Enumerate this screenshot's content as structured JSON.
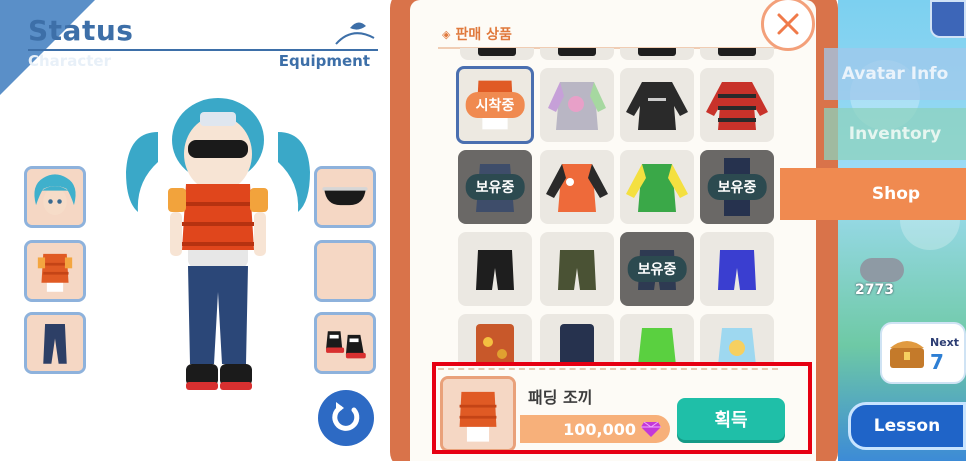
{
  "status_panel": {
    "title": "Status",
    "sub_left": "Character",
    "sub_right": "Equipment",
    "slots_left": [
      "hair-icon",
      "vest-icon",
      "pants-icon"
    ],
    "slots_right": [
      "sunglasses-icon",
      "empty-slot",
      "sneakers-icon"
    ]
  },
  "shop": {
    "title": "판매 상품",
    "items": [
      {
        "row": 1,
        "col": 1,
        "badge": "시착중",
        "state": "trying"
      },
      {
        "row": 1,
        "col": 2,
        "badge": "",
        "state": "normal"
      },
      {
        "row": 1,
        "col": 3,
        "badge": "",
        "state": "normal"
      },
      {
        "row": 1,
        "col": 4,
        "badge": "",
        "state": "normal"
      },
      {
        "row": 2,
        "col": 1,
        "badge": "보유중",
        "state": "owned"
      },
      {
        "row": 2,
        "col": 2,
        "badge": "",
        "state": "normal"
      },
      {
        "row": 2,
        "col": 3,
        "badge": "",
        "state": "normal"
      },
      {
        "row": 2,
        "col": 4,
        "badge": "보유중",
        "state": "owned"
      },
      {
        "row": 3,
        "col": 1,
        "badge": "",
        "state": "normal"
      },
      {
        "row": 3,
        "col": 2,
        "badge": "",
        "state": "normal"
      },
      {
        "row": 3,
        "col": 3,
        "badge": "보유중",
        "state": "owned"
      },
      {
        "row": 3,
        "col": 4,
        "badge": "",
        "state": "normal"
      }
    ],
    "detail": {
      "name": "패딩 조끼",
      "price": "100,000",
      "buy_label": "획득"
    }
  },
  "menu": {
    "avatar_info": "Avatar Info",
    "inventory": "Inventory",
    "shop": "Shop",
    "coins": "2773",
    "next_label": "Next",
    "next_value": "7",
    "lesson": "Lesson"
  },
  "colors": {
    "accent_blue": "#3d6fa8",
    "shop_orange": "#f08a50",
    "buy_teal": "#1fbfa8",
    "owned_badge": "#2c4a50",
    "highlight_red": "#e60012"
  }
}
